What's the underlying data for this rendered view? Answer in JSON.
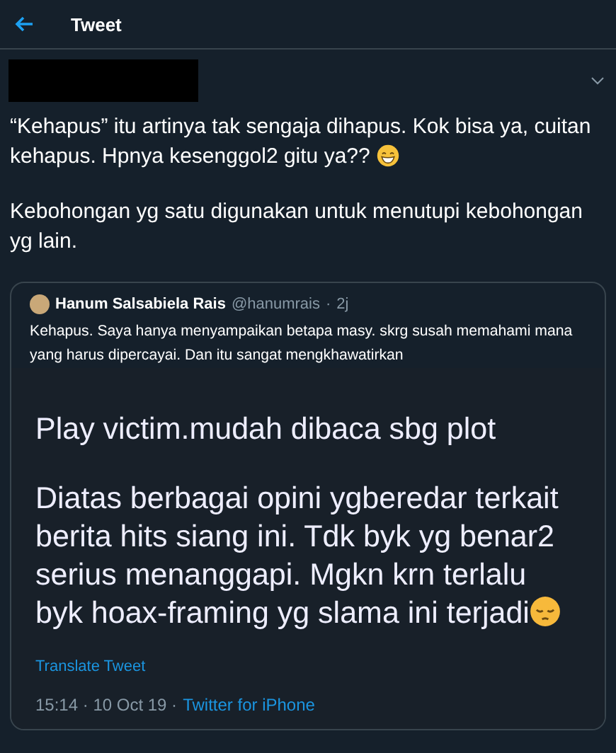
{
  "header": {
    "title": "Tweet"
  },
  "tweet": {
    "paragraphs": [
      {
        "kind": "grin",
        "text": "“Kehapus” itu artinya tak sengaja dihapus. Kok bisa ya, cuitan kehapus. Hpnya kesenggol2 gitu ya??"
      },
      {
        "kind": "plain",
        "text": "Kebohongan yg satu digunakan untuk menutupi kebohongan yg lain."
      }
    ]
  },
  "quote": {
    "name": "Hanum Salsabiela Rais",
    "handle": "@hanumrais",
    "separator": "·",
    "time": "2j",
    "text": "Kehapus. Saya hanya menyampaikan betapa masy. skrg susah memahami mana yang harus dipercayai. Dan itu sangat mengkhawatirkan",
    "screenshot": {
      "paragraphs": [
        {
          "kind": "plain",
          "text": "Play victim.mudah dibaca sbg plot"
        },
        {
          "kind": "sad",
          "text": "Diatas berbagai opini ygberedar terkait berita hits siang ini. Tdk byk yg benar2 serius menanggapi. Mgkn krn terlalu byk hoax-framing yg slama ini terjadi"
        }
      ],
      "translate": "Translate Tweet",
      "timestamp": "15:14 · 10 Oct 19 ·",
      "source": "Twitter for iPhone"
    }
  }
}
